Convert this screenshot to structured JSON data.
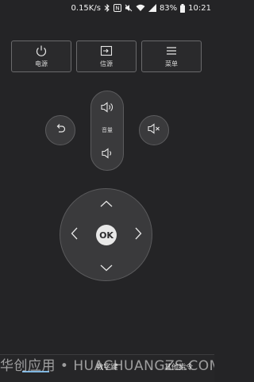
{
  "status_bar": {
    "network_speed": "0.15K/s",
    "battery_percent": "83%",
    "time": "10:21",
    "icons": [
      "bluetooth-icon",
      "nfc-icon",
      "mute-icon",
      "wifi-icon",
      "signal-icon",
      "battery-icon"
    ]
  },
  "top_buttons": [
    {
      "label": "电源",
      "icon": "power-icon"
    },
    {
      "label": "信源",
      "icon": "input-source-icon"
    },
    {
      "label": "菜单",
      "icon": "menu-icon"
    }
  ],
  "remote": {
    "back_icon": "back-icon",
    "mute_icon": "mute-icon",
    "volume_label": "音量",
    "volume_up_icon": "volume-up-icon",
    "volume_down_icon": "volume-down-icon",
    "ok_label": "OK"
  },
  "bottom_tabs": [
    {
      "label": "",
      "active": true
    },
    {
      "label": "数字键",
      "active": false
    },
    {
      "label": "其他指令",
      "active": false
    }
  ],
  "watermark": "华创应用 • HUACHUANGZS.COM",
  "colors": {
    "background": "#242426",
    "button_fill": "#3a3a3c",
    "accent": "#7fb6e0"
  }
}
